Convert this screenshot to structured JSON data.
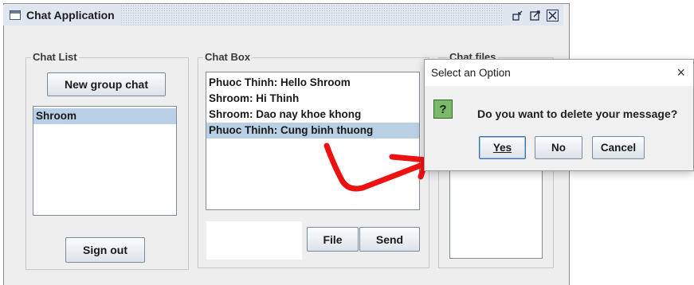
{
  "window": {
    "title": "Chat Application",
    "buttons": {
      "restore_icon": "restore-icon",
      "maximize_icon": "maximize-icon",
      "close_icon": "close-icon"
    }
  },
  "chat_list": {
    "title": "Chat List",
    "new_group_label": "New group chat",
    "items": [
      "Shroom"
    ],
    "selected": "Shroom",
    "sign_out_label": "Sign out"
  },
  "chat_box": {
    "title": "Chat Box",
    "messages": [
      "Phuoc Thinh: Hello Shroom",
      "Shroom: Hi Thinh",
      "Shroom: Dao nay khoe khong",
      "Phuoc Thinh: Cung binh thuong"
    ],
    "selected_index": 3,
    "message_input": "",
    "file_label": "File",
    "send_label": "Send"
  },
  "chat_files": {
    "title": "Chat files",
    "items": []
  },
  "dialog": {
    "title": "Select an Option",
    "close_symbol": "×",
    "icon": "question-icon",
    "icon_glyph": "?",
    "message": "Do you want to delete your message?",
    "yes_label": "Yes",
    "no_label": "No",
    "cancel_label": "Cancel"
  },
  "annotation": {
    "color": "#ee1111"
  },
  "colors": {
    "selection": "#b8cfe5",
    "panel_bg": "#eeeeee"
  }
}
